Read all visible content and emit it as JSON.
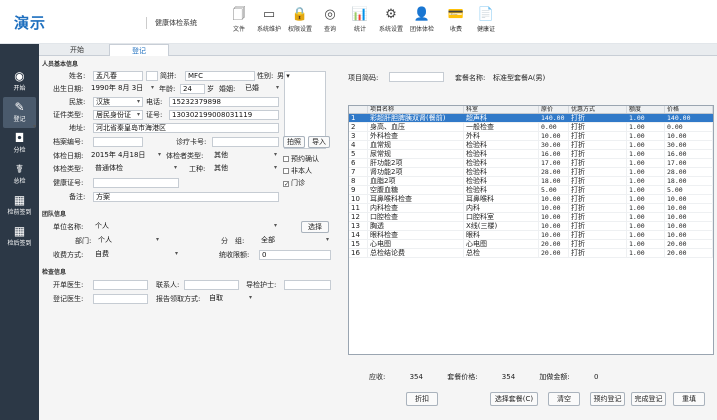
{
  "header": {
    "logo": "演示",
    "app_name": "健康体检系统"
  },
  "toolbar": [
    {
      "label": "文件",
      "icon": "file-icon",
      "glyph": "🗍"
    },
    {
      "label": "系统维护",
      "icon": "monitor-icon",
      "glyph": "▭"
    },
    {
      "label": "权限设置",
      "icon": "lock-icon",
      "glyph": "🔒"
    },
    {
      "label": "查询",
      "icon": "compass-icon",
      "glyph": "◎"
    },
    {
      "label": "统计",
      "icon": "bar-chart-icon",
      "glyph": "📊"
    },
    {
      "label": "系统设置",
      "icon": "gear-icon",
      "glyph": "⚙"
    },
    {
      "label": "团体体检",
      "icon": "group-icon",
      "glyph": "👤"
    },
    {
      "label": "收费",
      "icon": "money-user-icon",
      "glyph": "💳"
    },
    {
      "label": "健康证",
      "icon": "certificate-icon",
      "glyph": "📄"
    }
  ],
  "sidebar": [
    {
      "label": "开始",
      "icon": "home-icon",
      "glyph": "◉"
    },
    {
      "label": "登记",
      "icon": "register-icon",
      "glyph": "✎"
    },
    {
      "label": "分检",
      "icon": "check-icon",
      "glyph": "◘"
    },
    {
      "label": "总检",
      "icon": "summary-icon",
      "glyph": "☤"
    },
    {
      "label": "检前签到",
      "icon": "signin-icon",
      "glyph": "▦"
    },
    {
      "label": "检后签到",
      "icon": "signout-icon",
      "glyph": "▦"
    }
  ],
  "tabs": [
    {
      "label": "开始",
      "active": false
    },
    {
      "label": "登记",
      "active": true
    }
  ],
  "form": {
    "personal_section": "人员基本信息",
    "name_label": "姓名:",
    "name": "孟凡春",
    "spell_label": "简拼:",
    "spell": "MFC",
    "gender_label": "性别:",
    "gender": "男",
    "birth_label": "出生日期:",
    "birth": "1990年 8月 3日",
    "age": "24",
    "age_unit": "岁",
    "marital_label": "婚姻:",
    "marital": "已婚",
    "ethnic_label": "民族:",
    "ethnic": "汉族",
    "phone_label": "电话:",
    "phone": "15232379898",
    "idtype_label": "证件类型:",
    "idtype": "居民身份证",
    "idno_label": "证号:",
    "idno": "130302199008031119",
    "address_label": "地址:",
    "address": "河北省秦皇岛市海港区",
    "archive_label": "档案编号:",
    "archive": "",
    "medcard_label": "诊疗卡号:",
    "medcard": "",
    "photo_button": "拍照",
    "import_button": "导入",
    "exam_date_label": "体检日期:",
    "exam_date": "2015年 4月18日",
    "exam_patient_label": "体检者类型:",
    "exam_patient_type": "其他",
    "exam_type_label": "体检类型:",
    "exam_type": "普通体检",
    "job_label": "工种:",
    "job": "其他",
    "health_cert_label": "健康证号:",
    "health_cert": "",
    "remark_label": "备注:",
    "remark": "方案",
    "chk_appointment": "预约确认",
    "chk_nonlocal": "非本人",
    "chk_outpatient": "门诊",
    "team_section": "团队信息",
    "unit_label": "单位名称:",
    "unit": "个人",
    "select_button": "选择",
    "dept_label": "部门:",
    "dept": "个人",
    "group_label": "分　组:",
    "group": "全部",
    "pay_label": "收费方式:",
    "pay": "自费",
    "limit_label": "统收限额:",
    "limit": "0",
    "exam_info_section": "检查信息",
    "doctor_open_label": "开单医生:",
    "contact_label": "联系人:",
    "nurse_label": "导检护士:",
    "registrar_label": "登记医生:",
    "report_label": "报告领取方式:",
    "report": "自取"
  },
  "project": {
    "code_label": "项目简码:",
    "code": "",
    "package_label": "套餐名称:",
    "package": "标准型套餐A(男)"
  },
  "grid": {
    "columns": [
      "",
      "项目名称",
      "科室",
      "原价",
      "优惠方式",
      "额度",
      "价格"
    ],
    "rows": [
      [
        "1",
        "彩超肝胆脾胰双肾(餐前)",
        "超声科",
        "140.00",
        "打折",
        "1.00",
        "140.00"
      ],
      [
        "2",
        "身高、血压",
        "一般检查",
        "0.00",
        "打折",
        "1.00",
        "0.00"
      ],
      [
        "3",
        "外科检查",
        "外科",
        "10.00",
        "打折",
        "1.00",
        "10.00"
      ],
      [
        "4",
        "血常规",
        "检验科",
        "30.00",
        "打折",
        "1.00",
        "30.00"
      ],
      [
        "5",
        "尿常规",
        "检验科",
        "16.00",
        "打折",
        "1.00",
        "16.00"
      ],
      [
        "6",
        "肝功能2项",
        "检验科",
        "17.00",
        "打折",
        "1.00",
        "17.00"
      ],
      [
        "7",
        "肾功能2项",
        "检验科",
        "28.00",
        "打折",
        "1.00",
        "28.00"
      ],
      [
        "8",
        "血脂2项",
        "检验科",
        "18.00",
        "打折",
        "1.00",
        "18.00"
      ],
      [
        "9",
        "空腹血糖",
        "检验科",
        "5.00",
        "打折",
        "1.00",
        "5.00"
      ],
      [
        "10",
        "耳鼻喉科检查",
        "耳鼻喉科",
        "10.00",
        "打折",
        "1.00",
        "10.00"
      ],
      [
        "11",
        "内科检查",
        "内科",
        "10.00",
        "打折",
        "1.00",
        "10.00"
      ],
      [
        "12",
        "口腔检查",
        "口腔科室",
        "10.00",
        "打折",
        "1.00",
        "10.00"
      ],
      [
        "13",
        "胸透",
        "X线(三楼)",
        "10.00",
        "打折",
        "1.00",
        "10.00"
      ],
      [
        "14",
        "眼科检查",
        "眼科",
        "10.00",
        "打折",
        "1.00",
        "10.00"
      ],
      [
        "15",
        "心电图",
        "心电图",
        "20.00",
        "打折",
        "1.00",
        "20.00"
      ],
      [
        "16",
        "总检结论费",
        "总检",
        "20.00",
        "打折",
        "1.00",
        "20.00"
      ]
    ]
  },
  "totals": {
    "due_label": "应收:",
    "due": "354",
    "package_price_label": "套餐价格:",
    "package_price": "354",
    "extra_label": "加做金额:",
    "extra": "0"
  },
  "actions": {
    "discount": "折扣",
    "select_package": "选择套餐(C)",
    "clear": "清空",
    "appointment": "预约登记",
    "complete": "完成登记",
    "reset": "重填"
  }
}
